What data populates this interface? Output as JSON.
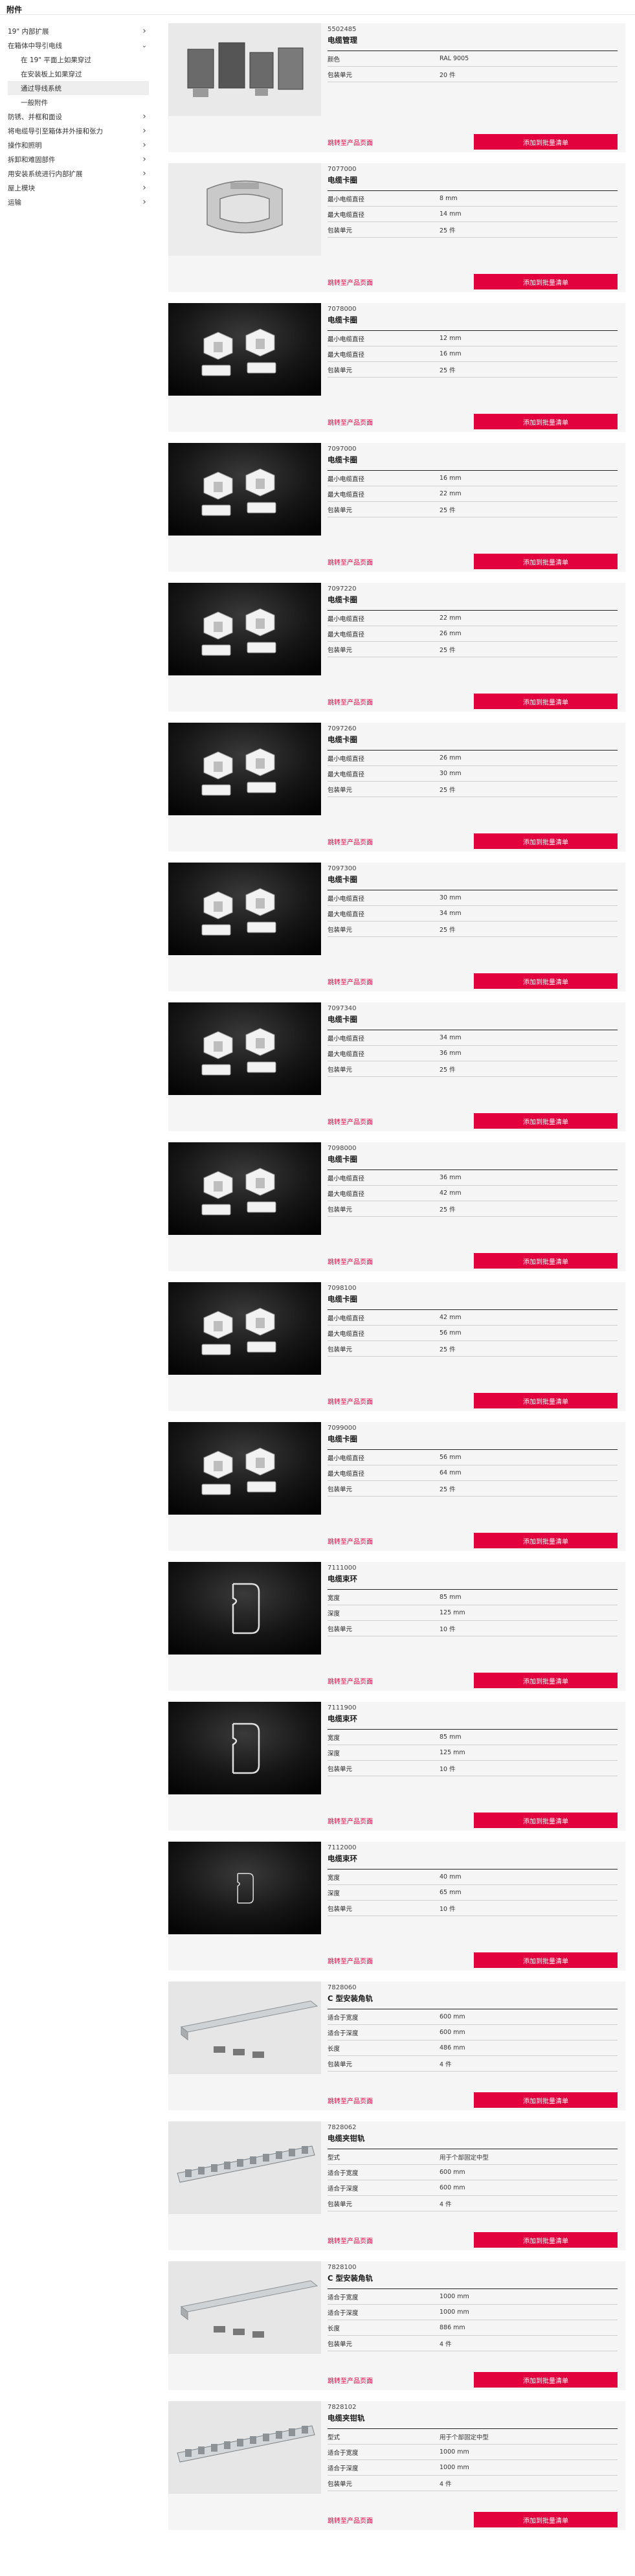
{
  "header": {
    "title": "附件"
  },
  "sidebar": {
    "items": [
      {
        "label": "19\" 内部扩展",
        "chevron": "right",
        "level": 0
      },
      {
        "label": "在箱体中导引电线",
        "chevron": "down",
        "level": 0
      },
      {
        "label": "在 19\" 平面上如果穿过",
        "chevron": "",
        "level": 1
      },
      {
        "label": "在安装板上如果穿过",
        "chevron": "",
        "level": 1
      },
      {
        "label": "通过导线系统",
        "chevron": "",
        "level": 1,
        "active": true
      },
      {
        "label": "一般附件",
        "chevron": "",
        "level": 2
      },
      {
        "label": "防锈、并框和面设",
        "chevron": "right",
        "level": 0
      },
      {
        "label": "将电缆导引至箱体并外接和张力",
        "chevron": "right",
        "level": 0
      },
      {
        "label": "操作和照明",
        "chevron": "right",
        "level": 0
      },
      {
        "label": "拆卸和难固部件",
        "chevron": "right",
        "level": 0
      },
      {
        "label": "用安装系统进行内部扩展",
        "chevron": "right",
        "level": 0
      },
      {
        "label": "屋上模块",
        "chevron": "right",
        "level": 0
      },
      {
        "label": "运输",
        "chevron": "right",
        "level": 0
      }
    ]
  },
  "actions": {
    "detail_label": "跳转至产品页面",
    "cart_label": "添加到批量清单"
  },
  "products": [
    {
      "sku": "5502485",
      "name": "电缆管理",
      "image": "cable-clamp-grey-photo",
      "specs": [
        {
          "label": "颜色",
          "value": "RAL 9005"
        },
        {
          "label": "包装单元",
          "value": "20 件"
        }
      ]
    },
    {
      "sku": "7077000",
      "name": "电缆卡圈",
      "image": "cable-clip-silver-photo",
      "specs": [
        {
          "label": "最小电缆直径",
          "value": "8 mm"
        },
        {
          "label": "最大电缆直径",
          "value": "14 mm"
        },
        {
          "label": "包装单元",
          "value": "25 件"
        }
      ]
    },
    {
      "sku": "7078000",
      "name": "电缆卡圈",
      "image": "cable-clip-white-pair-photo",
      "specs": [
        {
          "label": "最小电缆直径",
          "value": "12 mm"
        },
        {
          "label": "最大电缆直径",
          "value": "16 mm"
        },
        {
          "label": "包装单元",
          "value": "25 件"
        }
      ]
    },
    {
      "sku": "7097000",
      "name": "电缆卡圈",
      "image": "cable-clip-white-pair-photo",
      "specs": [
        {
          "label": "最小电缆直径",
          "value": "16 mm"
        },
        {
          "label": "最大电缆直径",
          "value": "22 mm"
        },
        {
          "label": "包装单元",
          "value": "25 件"
        }
      ]
    },
    {
      "sku": "7097220",
      "name": "电缆卡圈",
      "image": "cable-clip-white-pair-photo",
      "specs": [
        {
          "label": "最小电缆直径",
          "value": "22 mm"
        },
        {
          "label": "最大电缆直径",
          "value": "26 mm"
        },
        {
          "label": "包装单元",
          "value": "25 件"
        }
      ]
    },
    {
      "sku": "7097260",
      "name": "电缆卡圈",
      "image": "cable-clip-white-pair-photo",
      "specs": [
        {
          "label": "最小电缆直径",
          "value": "26 mm"
        },
        {
          "label": "最大电缆直径",
          "value": "30 mm"
        },
        {
          "label": "包装单元",
          "value": "25 件"
        }
      ]
    },
    {
      "sku": "7097300",
      "name": "电缆卡圈",
      "image": "cable-clip-white-pair-photo",
      "specs": [
        {
          "label": "最小电缆直径",
          "value": "30 mm"
        },
        {
          "label": "最大电缆直径",
          "value": "34 mm"
        },
        {
          "label": "包装单元",
          "value": "25 件"
        }
      ]
    },
    {
      "sku": "7097340",
      "name": "电缆卡圈",
      "image": "cable-clip-white-pair-photo",
      "specs": [
        {
          "label": "最小电缆直径",
          "value": "34 mm"
        },
        {
          "label": "最大电缆直径",
          "value": "36 mm"
        },
        {
          "label": "包装单元",
          "value": "25 件"
        }
      ]
    },
    {
      "sku": "7098000",
      "name": "电缆卡圈",
      "image": "cable-clip-white-pair-photo",
      "specs": [
        {
          "label": "最小电缆直径",
          "value": "36 mm"
        },
        {
          "label": "最大电缆直径",
          "value": "42 mm"
        },
        {
          "label": "包装单元",
          "value": "25 件"
        }
      ]
    },
    {
      "sku": "7098100",
      "name": "电缆卡圈",
      "image": "cable-clip-white-pair-photo",
      "specs": [
        {
          "label": "最小电缆直径",
          "value": "42 mm"
        },
        {
          "label": "最大电缆直径",
          "value": "56 mm"
        },
        {
          "label": "包装单元",
          "value": "25 件"
        }
      ]
    },
    {
      "sku": "7099000",
      "name": "电缆卡圈",
      "image": "cable-clip-white-pair-photo",
      "specs": [
        {
          "label": "最小电缆直径",
          "value": "56 mm"
        },
        {
          "label": "最大电缆直径",
          "value": "64 mm"
        },
        {
          "label": "包装单元",
          "value": "25 件"
        }
      ]
    },
    {
      "sku": "7111000",
      "name": "电缆束环",
      "image": "wire-loop-photo",
      "specs": [
        {
          "label": "宽度",
          "value": "85 mm"
        },
        {
          "label": "深度",
          "value": "125 mm"
        },
        {
          "label": "包装单元",
          "value": "10 件"
        }
      ]
    },
    {
      "sku": "7111900",
      "name": "电缆束环",
      "image": "wire-loop-wide-photo",
      "specs": [
        {
          "label": "宽度",
          "value": "85 mm"
        },
        {
          "label": "深度",
          "value": "125 mm"
        },
        {
          "label": "包装单元",
          "value": "10 件"
        }
      ]
    },
    {
      "sku": "7112000",
      "name": "电缆束环",
      "image": "wire-loop-small-photo",
      "specs": [
        {
          "label": "宽度",
          "value": "40 mm"
        },
        {
          "label": "深度",
          "value": "65 mm"
        },
        {
          "label": "包装单元",
          "value": "10 件"
        }
      ]
    },
    {
      "sku": "7828060",
      "name": "C 型安装角轨",
      "image": "c-rail-photo",
      "specs": [
        {
          "label": "适合于宽度",
          "value": "600 mm"
        },
        {
          "label": "适合于深度",
          "value": "600 mm"
        },
        {
          "label": "长度",
          "value": "486 mm"
        },
        {
          "label": "包装单元",
          "value": "4 件"
        }
      ]
    },
    {
      "sku": "7828062",
      "name": "电缆夹钳轨",
      "image": "clamp-rail-photo",
      "specs": [
        {
          "label": "型式",
          "value": "用于个部固定中型"
        },
        {
          "label": "适合于宽度",
          "value": "600 mm"
        },
        {
          "label": "适合于深度",
          "value": "600 mm"
        },
        {
          "label": "包装单元",
          "value": "4 件"
        }
      ]
    },
    {
      "sku": "7828100",
      "name": "C 型安装角轨",
      "image": "c-rail-photo",
      "specs": [
        {
          "label": "适合于宽度",
          "value": "1000 mm"
        },
        {
          "label": "适合于深度",
          "value": "1000 mm"
        },
        {
          "label": "长度",
          "value": "886 mm"
        },
        {
          "label": "包装单元",
          "value": "4 件"
        }
      ]
    },
    {
      "sku": "7828102",
      "name": "电缆夹钳轨",
      "image": "clamp-rail-photo",
      "specs": [
        {
          "label": "型式",
          "value": "用于个部固定中型"
        },
        {
          "label": "适合于宽度",
          "value": "1000 mm"
        },
        {
          "label": "适合于深度",
          "value": "1000 mm"
        },
        {
          "label": "包装单元",
          "value": "4 件"
        }
      ]
    }
  ]
}
